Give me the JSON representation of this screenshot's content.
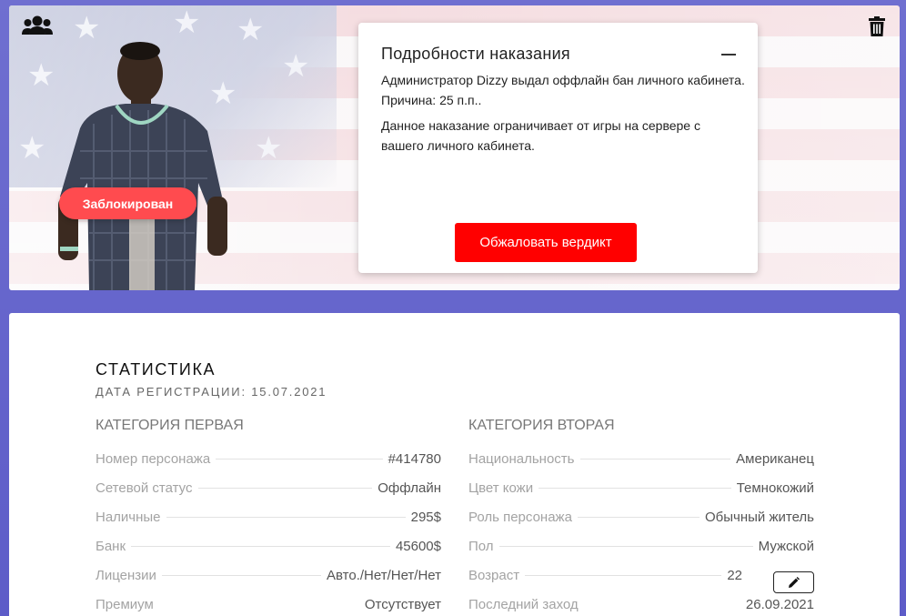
{
  "hero": {
    "badge_label": "Заблокирован",
    "punishment": {
      "title": "Подробности наказания",
      "text1": "Администратор Dizzy выдал оффлайн бан личного кабинета. Причина: 25 п.п..",
      "text2": "Данное наказание ограничивает от игры на сервере с вашего личного кабинета.",
      "appeal_label": "Обжаловать вердикт"
    }
  },
  "stats": {
    "title": "СТАТИСТИКА",
    "registration": "ДАТА РЕГИСТРАЦИИ: 15.07.2021",
    "category1": {
      "heading": "КАТЕГОРИЯ ПЕРВАЯ",
      "rows": [
        {
          "label": "Номер персонажа",
          "value": "#414780"
        },
        {
          "label": "Сетевой статус",
          "value": "Оффлайн"
        },
        {
          "label": "Наличные",
          "value": "295$"
        },
        {
          "label": "Банк",
          "value": "45600$"
        },
        {
          "label": "Лицензии",
          "value": "Авто./Нет/Нет/Нет"
        },
        {
          "label": "Премиум",
          "value": "Отсутствует"
        }
      ]
    },
    "category2": {
      "heading": "КАТЕГОРИЯ ВТОРАЯ",
      "rows": [
        {
          "label": "Национальность",
          "value": "Американец"
        },
        {
          "label": "Цвет кожи",
          "value": "Темнокожий"
        },
        {
          "label": "Роль персонажа",
          "value": "Обычный житель"
        },
        {
          "label": "Пол",
          "value": "Мужской"
        },
        {
          "label": "Возраст",
          "value": "22"
        },
        {
          "label": "Последний заход",
          "value": "26.09.2021"
        }
      ]
    }
  },
  "colors": {
    "background": "#6362cb",
    "danger": "#ff0000",
    "badge": "#ff4b4f"
  },
  "icons": [
    "users-icon",
    "trash-icon",
    "minus-icon",
    "pencil-icon"
  ]
}
